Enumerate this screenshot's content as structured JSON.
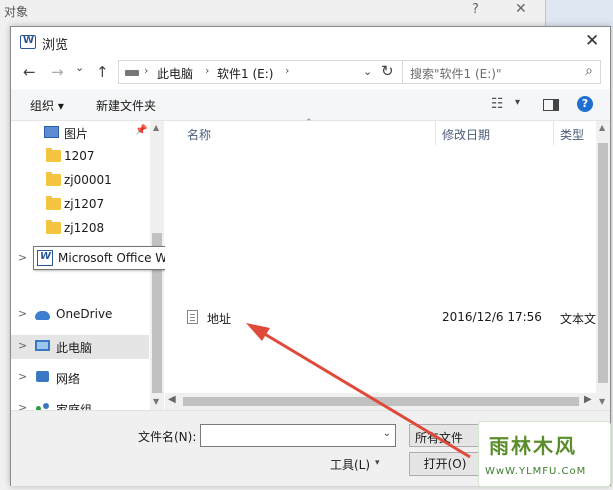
{
  "parent_dialog": {
    "title": "对象",
    "help_glyph": "?",
    "close_glyph": "✕"
  },
  "dialog": {
    "title": "浏览",
    "close_glyph": "✕"
  },
  "nav": {
    "back_glyph": "←",
    "forward_glyph": "→",
    "recent_glyph": "⌄",
    "up_glyph": "↑",
    "breadcrumb": [
      "此电脑",
      "软件1 (E:)"
    ],
    "crumb_separator": "›",
    "dropdown_glyph": "⌄",
    "refresh_glyph": "↻",
    "search_placeholder": "搜索\"软件1 (E:)\"",
    "search_glyph": "⌕"
  },
  "toolbar": {
    "organize_label": "组织 ▾",
    "new_folder_label": "新建文件夹",
    "view_glyph": "☷",
    "view_dropdown_glyph": "▾",
    "help_glyph": "?"
  },
  "sidebar": {
    "expand_glyph": ">",
    "pin_glyph": "📌",
    "items": [
      {
        "label": "图片",
        "icon": "pictures-icon"
      },
      {
        "label": "1207",
        "icon": "folder-icon"
      },
      {
        "label": "zj00001",
        "icon": "folder-icon"
      },
      {
        "label": "zj1207",
        "icon": "folder-icon"
      },
      {
        "label": "zj1208",
        "icon": "folder-icon"
      },
      {
        "label": "OneDrive",
        "icon": "cloud-icon"
      },
      {
        "label": "此电脑",
        "icon": "computer-icon",
        "selected": true
      },
      {
        "label": "网络",
        "icon": "network-icon"
      },
      {
        "label": "家庭组",
        "icon": "homegroup-icon"
      }
    ]
  },
  "tooltip": {
    "text": "Microsoft Office Word"
  },
  "file_list": {
    "columns": [
      "名称",
      "修改日期",
      "类型"
    ],
    "sort_glyph": "⌃",
    "rows": [
      {
        "name": "地址",
        "modified": "2016/12/6 17:56",
        "type": "文本文"
      }
    ]
  },
  "bottom": {
    "filename_label": "文件名(N):",
    "filename_value": "",
    "filetype_value": "所有文件",
    "tools_label": "工具(L)",
    "open_label": "打开(O)",
    "dropdown_glyph": "⌄",
    "small_dropdown_glyph": "▾"
  },
  "watermark": {
    "main": "雨林木风",
    "url": "WwW.YLMFU.CoM"
  },
  "colors": {
    "arrow": "#e04a3a",
    "selection": "#e5e5e5",
    "accent": "#1f6fd1"
  }
}
